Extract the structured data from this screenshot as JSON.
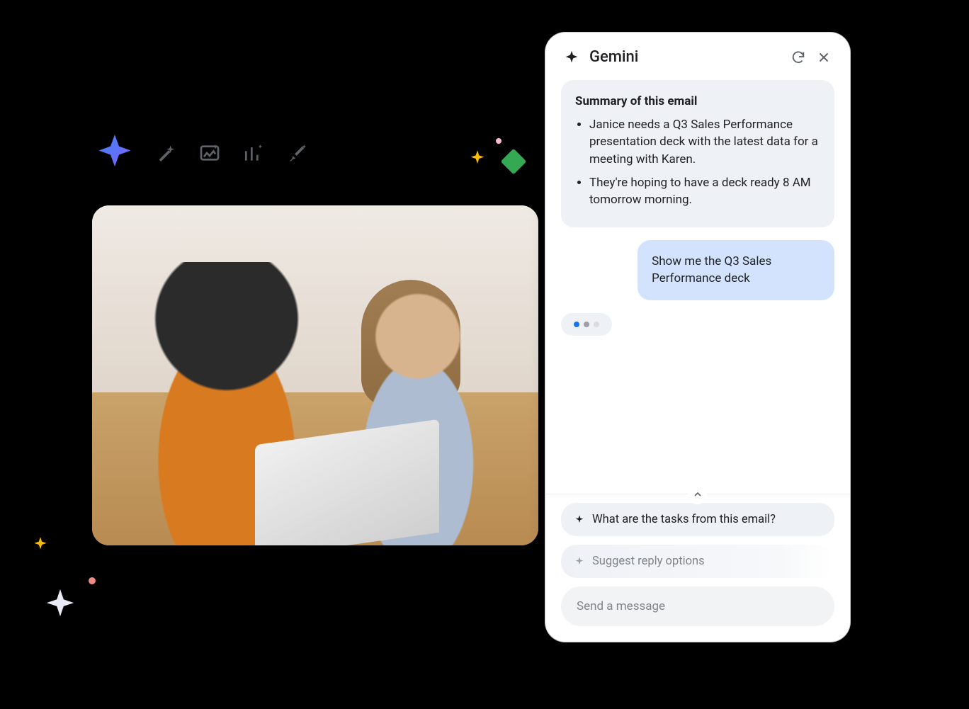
{
  "panel": {
    "title": "Gemini",
    "ai_message": {
      "title": "Summary of this email",
      "bullets": [
        "Janice needs a Q3 Sales Performance presentation deck with the latest data for a meeting with Karen.",
        "They're hoping to have a deck ready 8 AM tomorrow morning."
      ]
    },
    "user_message": "Show me the Q3 Sales Performance deck",
    "suggestions": [
      "What are the tasks from this email?",
      "Suggest reply options"
    ],
    "input_placeholder": "Send a message"
  }
}
